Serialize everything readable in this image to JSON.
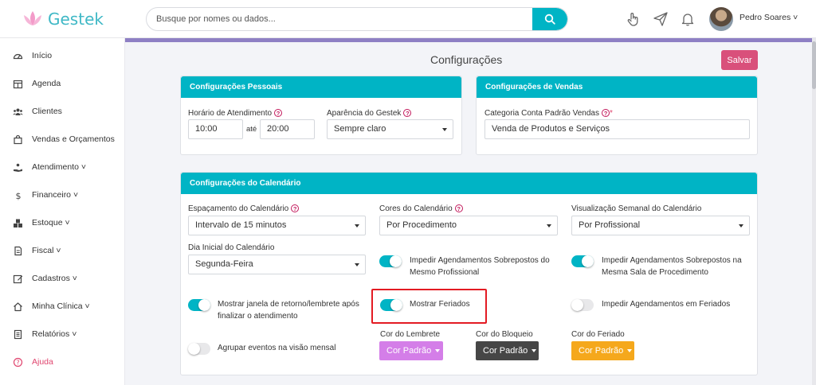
{
  "app": {
    "name": "Gestek"
  },
  "search": {
    "placeholder": "Busque por nomes ou dados..."
  },
  "user": {
    "name": "Pedro Soares ˅"
  },
  "sidebar": {
    "items": [
      {
        "label": "Início",
        "icon": "dashboard-icon"
      },
      {
        "label": "Agenda",
        "icon": "calendar-icon"
      },
      {
        "label": "Clientes",
        "icon": "users-icon"
      },
      {
        "label": "Vendas e Orçamentos",
        "icon": "shopping-bag-icon"
      },
      {
        "label": "Atendimento ˅",
        "icon": "hand-service-icon"
      },
      {
        "label": "Financeiro ˅",
        "icon": "dollar-icon"
      },
      {
        "label": "Estoque ˅",
        "icon": "boxes-icon"
      },
      {
        "label": "Fiscal ˅",
        "icon": "document-icon"
      },
      {
        "label": "Cadastros ˅",
        "icon": "edit-icon"
      },
      {
        "label": "Minha Clínica ˅",
        "icon": "home-icon"
      },
      {
        "label": "Relatórios ˅",
        "icon": "report-icon"
      },
      {
        "label": "Ajuda",
        "icon": "help-circle-icon"
      }
    ]
  },
  "page": {
    "title": "Configurações",
    "save_label": "Salvar"
  },
  "personal": {
    "header": "Configurações Pessoais",
    "hours_label": "Horário de Atendimento",
    "hours_start": "10:00",
    "hours_sep": "até",
    "hours_end": "20:00",
    "appearance_label": "Aparência do Gestek",
    "appearance_value": "Sempre claro"
  },
  "sales": {
    "header": "Configurações de Vendas",
    "category_label": "Categoria Conta Padrão Vendas",
    "required_mark": "*",
    "category_value": "Venda de Produtos e Serviços"
  },
  "calendar": {
    "header": "Configurações do Calendário",
    "spacing_label": "Espaçamento do Calendário",
    "spacing_value": "Intervalo de 15 minutos",
    "colors_label": "Cores do Calendário",
    "colors_value": "Por Procedimento",
    "weekly_label": "Visualização Semanal do Calendário",
    "weekly_value": "Por Profissional",
    "start_day_label": "Dia Inicial do Calendário",
    "start_day_value": "Segunda-Feira",
    "toggles": {
      "block_overlap_prof": {
        "line1": "Impedir Agendamentos Sobrepostos do",
        "line2": "Mesmo Profissional",
        "on": true
      },
      "block_overlap_room": {
        "line1": "Impedir Agendamentos Sobrepostos na",
        "line2": "Mesma Sala de Procedimento",
        "on": true
      },
      "show_return": {
        "line1": "Mostrar janela de retorno/lembrete após",
        "line2": "finalizar o atendimento",
        "on": true
      },
      "show_holidays": {
        "line1": "Mostrar Feriados",
        "on": true
      },
      "block_holidays": {
        "line1": "Impedir Agendamentos em Feriados",
        "on": false
      },
      "group_monthly": {
        "line1": "Agrupar eventos na visão mensal",
        "on": false
      }
    },
    "reminder_color_label": "Cor do Lembrete",
    "block_color_label": "Cor do Bloqueio",
    "holiday_color_label": "Cor do Feriado",
    "default_color_label": "Cor Padrão",
    "colors": {
      "reminder": "#d47ee8",
      "block": "#464646",
      "holiday": "#f5a81c",
      "accent": "#00b4c5",
      "save": "#d9507b"
    }
  }
}
